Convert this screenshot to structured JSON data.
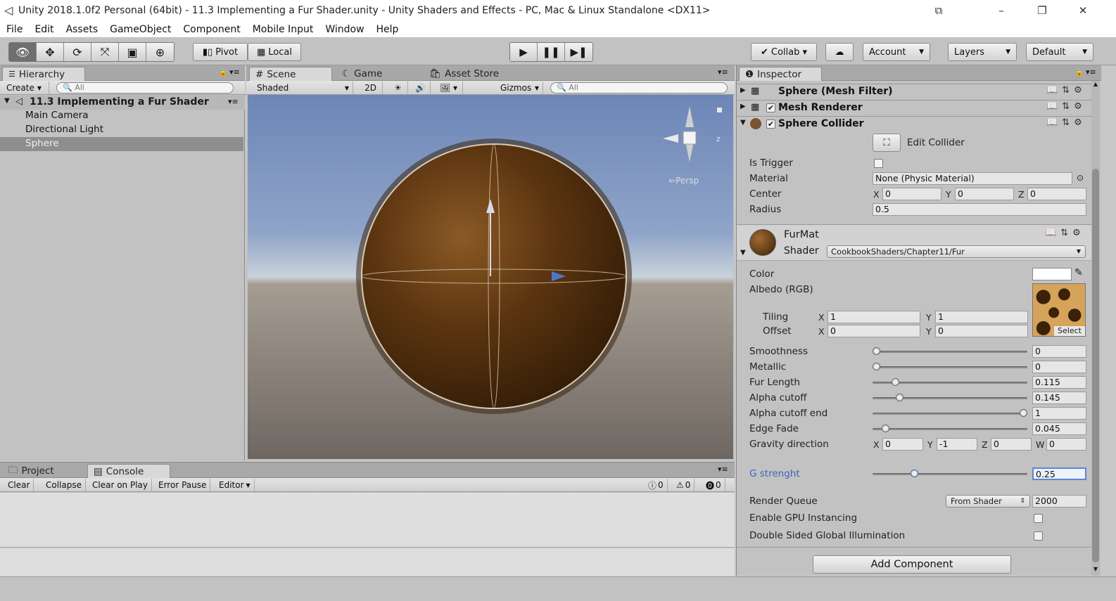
{
  "window": {
    "title": "Unity 2018.1.0f2 Personal (64bit) - 11.3 Implementing a Fur Shader.unity - Unity Shaders and Effects - PC, Mac & Linux Standalone <DX11>"
  },
  "menu": [
    "File",
    "Edit",
    "Assets",
    "GameObject",
    "Component",
    "Mobile Input",
    "Window",
    "Help"
  ],
  "toolbar": {
    "pivot": "Pivot",
    "local": "Local",
    "collab": "Collab ▾",
    "account": "Account",
    "layers": "Layers",
    "layout": "Default"
  },
  "hierarchy": {
    "tab": "Hierarchy",
    "create": "Create",
    "search": "All",
    "scene": "11.3 Implementing a Fur Shader",
    "items": [
      "Main Camera",
      "Directional Light",
      "Sphere"
    ]
  },
  "scene": {
    "tabs": [
      "Scene",
      "Game",
      "Asset Store"
    ],
    "shading": "Shaded",
    "mode2d": "2D",
    "gizmos": "Gizmos",
    "search": "All",
    "persp": "Persp",
    "axis_z": "z"
  },
  "bottom": {
    "tabs": [
      "Project",
      "Console"
    ],
    "buttons": [
      "Clear",
      "Collapse",
      "Clear on Play",
      "Error Pause",
      "Editor"
    ],
    "counts": [
      "0",
      "0",
      "0"
    ]
  },
  "inspector": {
    "tab": "Inspector",
    "components": [
      "Sphere (Mesh Filter)",
      "Mesh Renderer",
      "Sphere Collider"
    ],
    "edit_collider": "Edit Collider",
    "collider": {
      "is_trigger": "Is Trigger",
      "material_label": "Material",
      "material": "None (Physic Material)",
      "center_label": "Center",
      "center": [
        "0",
        "0",
        "0"
      ],
      "radius_label": "Radius",
      "radius": "0.5"
    },
    "material": {
      "name": "FurMat",
      "shader_label": "Shader",
      "shader": "CookbookShaders/Chapter11/Fur"
    },
    "props": {
      "color": "Color",
      "albedo": "Albedo (RGB)",
      "tiling": "Tiling",
      "offset": "Offset",
      "tiling_vals": [
        "1",
        "1"
      ],
      "offset_vals": [
        "0",
        "0"
      ],
      "select": "Select"
    },
    "sliders": [
      {
        "label": "Smoothness",
        "value": "0",
        "level": 0.0
      },
      {
        "label": "Metallic",
        "value": "0",
        "level": 0.0
      },
      {
        "label": "Fur Length",
        "value": "0.115",
        "level": 0.13
      },
      {
        "label": "Alpha cutoff",
        "value": "0.145",
        "level": 0.16
      },
      {
        "label": "Alpha cutoff end",
        "value": "1",
        "level": 1.0
      },
      {
        "label": "Edge Fade",
        "value": "0.045",
        "level": 0.06
      }
    ],
    "gravity": {
      "label": "Gravity direction",
      "values": [
        "0",
        "-1",
        "0",
        "0"
      ]
    },
    "g_strength": {
      "label": "G strenght",
      "value": "0.25",
      "level": 0.26
    },
    "render_queue": {
      "label": "Render Queue",
      "mode": "From Shader",
      "value": "2000"
    },
    "gpu_instancing": "Enable GPU Instancing",
    "double_sided": "Double Sided Global Illumination",
    "add_component": "Add Component"
  },
  "axis_labels": {
    "x": "X",
    "y": "Y",
    "z": "Z",
    "w": "W"
  },
  "colors": {
    "accent_blue": "#3a63b8",
    "fur_brown": "#5a3410"
  }
}
